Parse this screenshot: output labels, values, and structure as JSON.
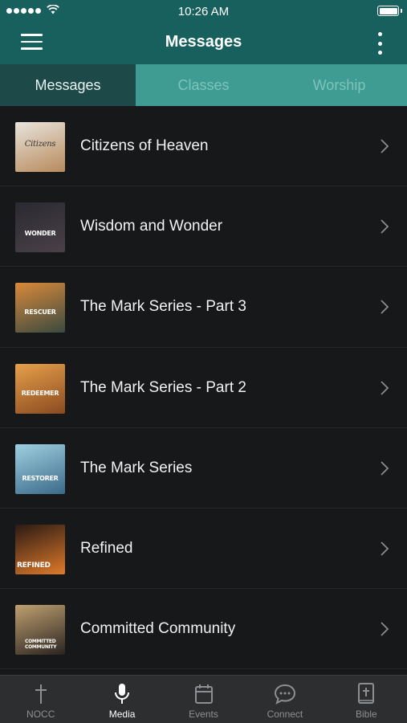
{
  "status_bar": {
    "time": "10:26 AM"
  },
  "header": {
    "title": "Messages"
  },
  "tabs": [
    {
      "label": "Messages",
      "active": true
    },
    {
      "label": "Classes",
      "active": false
    },
    {
      "label": "Worship",
      "active": false
    }
  ],
  "items": [
    {
      "title": "Citizens of Heaven",
      "thumb_text": "Citizens",
      "thumb_colors": [
        "#e8e4dc",
        "#b88a5c"
      ]
    },
    {
      "title": "Wisdom and Wonder",
      "thumb_text": "WONDER",
      "thumb_colors": [
        "#2a2a30",
        "#4a4048"
      ]
    },
    {
      "title": "The Mark Series - Part 3",
      "thumb_text": "RESCUER",
      "thumb_colors": [
        "#d9893a",
        "#3a4a40"
      ]
    },
    {
      "title": "The Mark Series - Part 2",
      "thumb_text": "REDEEMER",
      "thumb_colors": [
        "#e6a04a",
        "#8a4a20"
      ]
    },
    {
      "title": "The Mark Series",
      "thumb_text": "RESTORER",
      "thumb_colors": [
        "#9fd0e0",
        "#3a6a8a"
      ]
    },
    {
      "title": "Refined",
      "thumb_text": "REFINED",
      "thumb_colors": [
        "#2a1a14",
        "#e07a2a"
      ]
    },
    {
      "title": "Committed Community",
      "thumb_text": "COMMITTED COMMUNITY",
      "thumb_colors": [
        "#c0a070",
        "#2a2420"
      ]
    }
  ],
  "tab_bar": [
    {
      "label": "NOCC",
      "icon": "cross-icon",
      "active": false
    },
    {
      "label": "Media",
      "icon": "microphone-icon",
      "active": true
    },
    {
      "label": "Events",
      "icon": "calendar-icon",
      "active": false
    },
    {
      "label": "Connect",
      "icon": "chat-bubble-icon",
      "active": false
    },
    {
      "label": "Bible",
      "icon": "bible-icon",
      "active": false
    }
  ],
  "colors": {
    "header_bg": "#17605e",
    "tabs_bg": "#3f9c92",
    "active_tab_bg": "#1d4a48",
    "list_bg": "#161819",
    "tab_bar_bg": "#2c2e30"
  }
}
